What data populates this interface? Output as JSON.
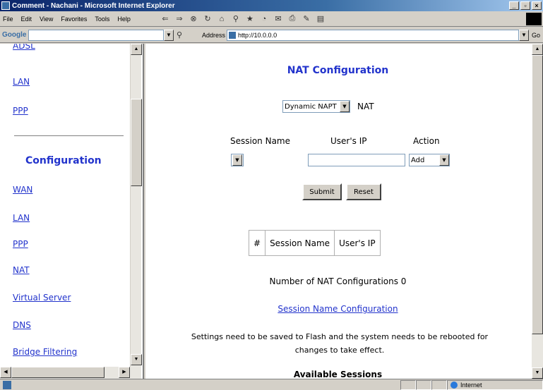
{
  "window": {
    "title": "Comment - Nachani - Microsoft Internet Explorer"
  },
  "menu": [
    "File",
    "Edit",
    "View",
    "Favorites",
    "Tools",
    "Help"
  ],
  "google": {
    "label": "Google -"
  },
  "address": {
    "label": "Address",
    "value": "http://10.0.0.0",
    "go_label": "Go"
  },
  "sidebar": {
    "top_links": [
      "ADSL",
      "LAN",
      "PPP"
    ],
    "config_title": "Configuration",
    "config_links": [
      "WAN",
      "LAN",
      "PPP",
      "NAT",
      "Virtual Server",
      "DNS",
      "Bridge Filtering"
    ]
  },
  "main": {
    "title": "NAT Configuration",
    "mode_select": "Dynamic NAPT",
    "mode_label": "NAT",
    "headers": {
      "session_name": "Session Name",
      "users_ip": "User's IP",
      "action": "Action"
    },
    "action_select": "Add",
    "submit_label": "Submit",
    "reset_label": "Reset",
    "table_headers": [
      "#",
      "Session Name",
      "User's IP"
    ],
    "count_text": "Number of NAT Configurations 0",
    "session_link": "Session Name Configuration",
    "notice_line1": "Settings need to be saved to Flash and the system needs to be rebooted for",
    "notice_line2": "changes to take effect.",
    "available_sessions": "Available Sessions"
  },
  "status": {
    "zone": "Internet"
  }
}
